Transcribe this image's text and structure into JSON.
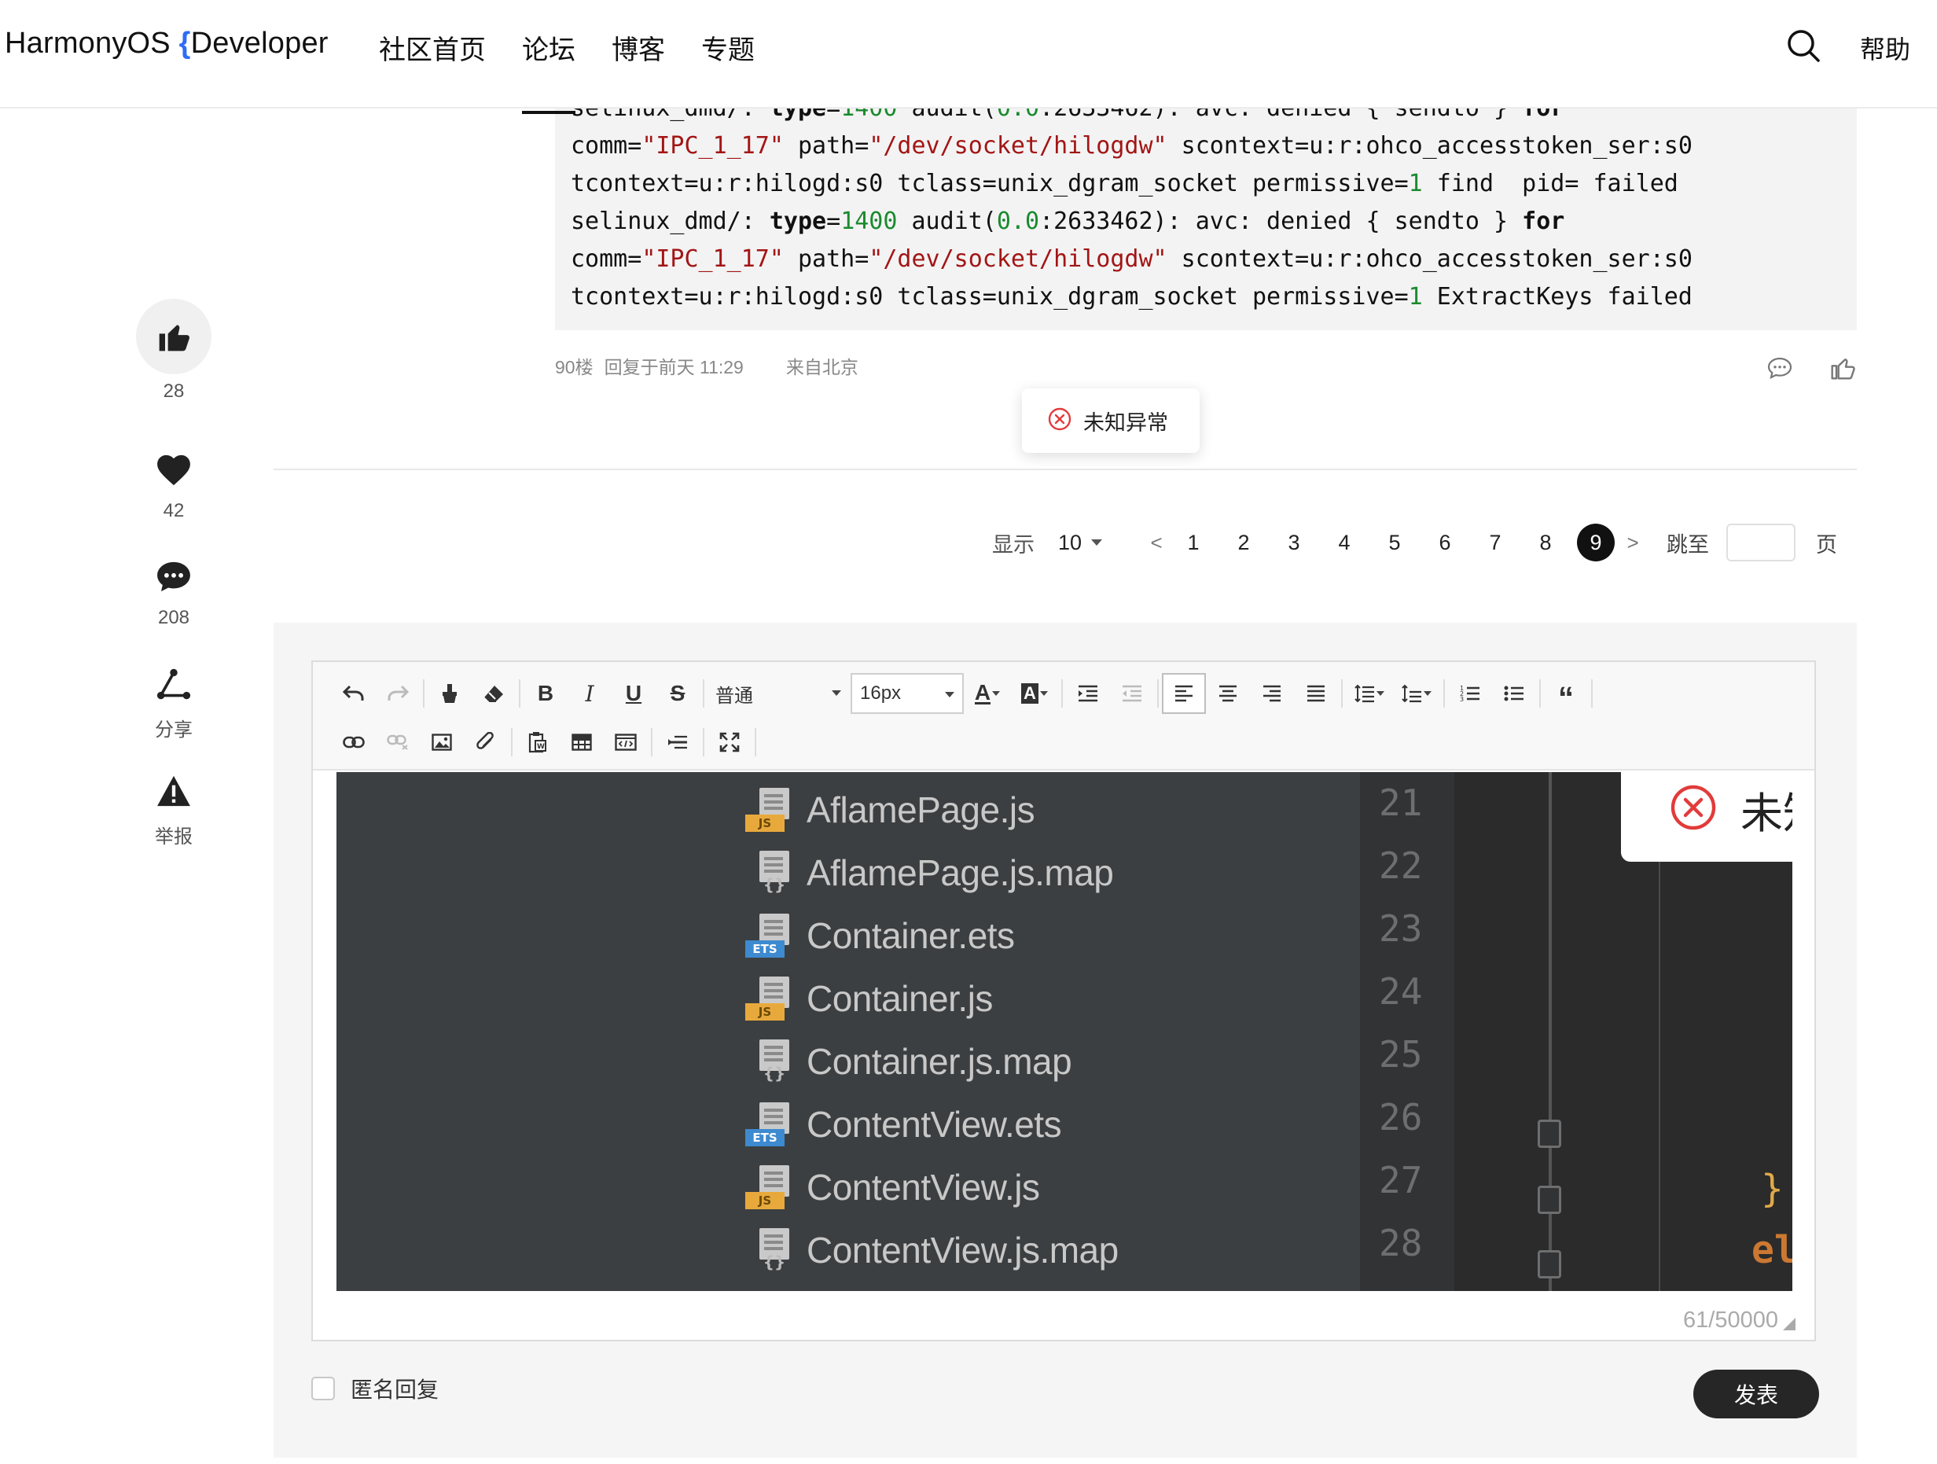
{
  "header": {
    "logo_left": "HarmonyOS",
    "logo_bracket": "{",
    "logo_right": "Developer",
    "nav": [
      "社区首页",
      "论坛",
      "博客",
      "专题"
    ],
    "help": "帮助"
  },
  "rail": {
    "like_count": "28",
    "favorite_count": "42",
    "comment_count": "208",
    "share_label": "分享",
    "report_label": "举报"
  },
  "code_block": {
    "line0_cmd": "selinux_dmd/: ",
    "line0_kw": "type",
    "line0_eq": "=",
    "line0_num": "1400",
    "line0_rest": " audit(",
    "line0_num2": "0.0",
    "line0_rest2": ":2633462): avc: denied { sendto } ",
    "line0_for": "for",
    "line1_a": "comm=",
    "line1_s1": "\"IPC_1_17\"",
    "line1_b": " path=",
    "line1_s2": "\"/dev/socket/hilogdw\"",
    "line1_c": " scontext=u:r:ohco_accesstoken_ser:s0",
    "line2_a": "tcontext=u:r:hilogd:s0 tclass=unix_dgram_socket permissive=",
    "line2_num": "1",
    "line2_b": " find  pid= failed",
    "line3_a": "selinux_dmd/: ",
    "line3_kw": "type",
    "line3_eq": "=",
    "line3_num": "1400",
    "line3_b": " audit(",
    "line3_num2": "0.0",
    "line3_c": ":2633462): avc: denied { sendto } ",
    "line3_for": "for",
    "line4_a": "comm=",
    "line4_s1": "\"IPC_1_17\"",
    "line4_b": " path=",
    "line4_s2": "\"/dev/socket/hilogdw\"",
    "line4_c": " scontext=u:r:ohco_accesstoken_ser:s0",
    "line5_a": "tcontext=u:r:hilogd:s0 tclass=unix_dgram_socket permissive=",
    "line5_num": "1",
    "line5_b": " ExtractKeys failed"
  },
  "floor": {
    "floor": "90楼",
    "reply_time": "回复于前天 11:29",
    "location": "来自北京"
  },
  "toast": {
    "text": "未知异常"
  },
  "pager": {
    "show_label": "显示",
    "page_size": "10",
    "prev": "<",
    "pages": [
      "1",
      "2",
      "3",
      "4",
      "5",
      "6",
      "7",
      "8",
      "9"
    ],
    "current": "9",
    "next": ">",
    "jump_label": "跳至",
    "page_label": "页"
  },
  "editor": {
    "paragraph_select": "普通",
    "font_size_select": "16px",
    "bold": "B",
    "italic": "I",
    "underline": "U",
    "strike": "S",
    "font_color": "A",
    "bg_color": "A",
    "quote": "“",
    "pasted_image": {
      "files": [
        {
          "name": "AflamePage.js",
          "type": "JS",
          "line": "21"
        },
        {
          "name": "AflamePage.js.map",
          "type": "{}",
          "line": "22"
        },
        {
          "name": "Container.ets",
          "type": "ETS",
          "line": "23"
        },
        {
          "name": "Container.js",
          "type": "JS",
          "line": "24"
        },
        {
          "name": "Container.js.map",
          "type": "{}",
          "line": "25"
        },
        {
          "name": "ContentView.ets",
          "type": "ETS",
          "line": "26"
        },
        {
          "name": "ContentView.js",
          "type": "JS",
          "line": "27"
        },
        {
          "name": "ContentView.js.map",
          "type": "{}",
          "line": "28"
        }
      ],
      "brace": "}",
      "code_fragment": "el",
      "toast_text": "未知"
    },
    "char_count": "61/50000"
  },
  "reply": {
    "anonymous_label": "匿名回复",
    "publish_label": "发表"
  },
  "colors": {
    "string": "#a31515",
    "number": "#1b8a2f",
    "brand_blue": "#2f6cf6",
    "active_page": "#111111",
    "toast_error": "#e23b3b",
    "publish_bg": "#262626"
  }
}
